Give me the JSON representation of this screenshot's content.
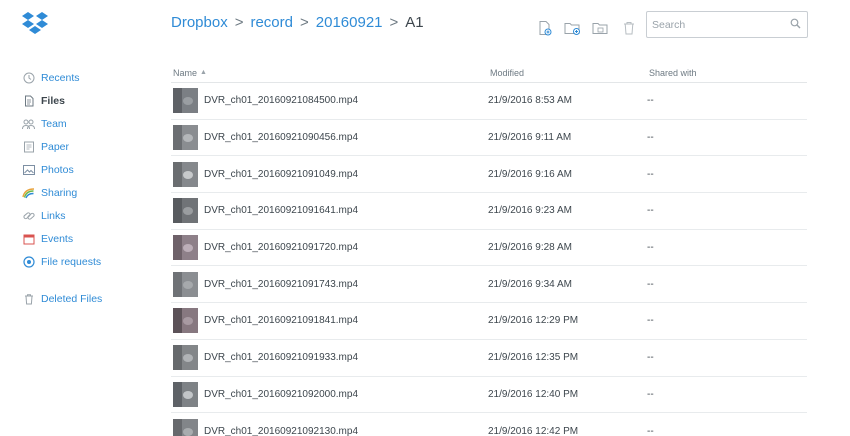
{
  "brand": {
    "logo_icon": "dropbox-logo-icon",
    "accent": "#2f8bd6"
  },
  "sidebar": {
    "items": [
      {
        "label": "Recents",
        "icon": "clock-icon",
        "active": false
      },
      {
        "label": "Files",
        "icon": "file-icon",
        "active": true
      },
      {
        "label": "Team",
        "icon": "team-icon",
        "active": false
      },
      {
        "label": "Paper",
        "icon": "paper-icon",
        "active": false
      },
      {
        "label": "Photos",
        "icon": "photos-icon",
        "active": false
      },
      {
        "label": "Sharing",
        "icon": "sharing-icon",
        "active": false
      },
      {
        "label": "Links",
        "icon": "link-icon",
        "active": false
      },
      {
        "label": "Events",
        "icon": "calendar-icon",
        "active": false
      },
      {
        "label": "File requests",
        "icon": "file-request-icon",
        "active": false
      }
    ],
    "deleted_label": "Deleted Files"
  },
  "breadcrumb": {
    "items": [
      "Dropbox",
      "record",
      "20160921"
    ],
    "separator": ">",
    "current": "A1"
  },
  "toolbar": {
    "icons": [
      "upload-file-icon",
      "new-shared-folder-icon",
      "new-folder-icon",
      "trash-icon"
    ]
  },
  "search": {
    "placeholder": "Search",
    "value": ""
  },
  "table": {
    "headers": {
      "name": "Name",
      "modified": "Modified",
      "shared": "Shared with"
    },
    "sort_indicator": "▲",
    "rows": [
      {
        "name": "DVR_ch01_20160921084500.mp4",
        "modified": "21/9/2016 8:53 AM",
        "shared": "--"
      },
      {
        "name": "DVR_ch01_20160921090456.mp4",
        "modified": "21/9/2016 9:11 AM",
        "shared": "--"
      },
      {
        "name": "DVR_ch01_20160921091049.mp4",
        "modified": "21/9/2016 9:16 AM",
        "shared": "--"
      },
      {
        "name": "DVR_ch01_20160921091641.mp4",
        "modified": "21/9/2016 9:23 AM",
        "shared": "--"
      },
      {
        "name": "DVR_ch01_20160921091720.mp4",
        "modified": "21/9/2016 9:28 AM",
        "shared": "--"
      },
      {
        "name": "DVR_ch01_20160921091743.mp4",
        "modified": "21/9/2016 9:34 AM",
        "shared": "--"
      },
      {
        "name": "DVR_ch01_20160921091841.mp4",
        "modified": "21/9/2016 12:29 PM",
        "shared": "--"
      },
      {
        "name": "DVR_ch01_20160921091933.mp4",
        "modified": "21/9/2016 12:35 PM",
        "shared": "--"
      },
      {
        "name": "DVR_ch01_20160921092000.mp4",
        "modified": "21/9/2016 12:40 PM",
        "shared": "--"
      },
      {
        "name": "DVR_ch01_20160921092130.mp4",
        "modified": "21/9/2016 12:42 PM",
        "shared": "--"
      }
    ]
  }
}
